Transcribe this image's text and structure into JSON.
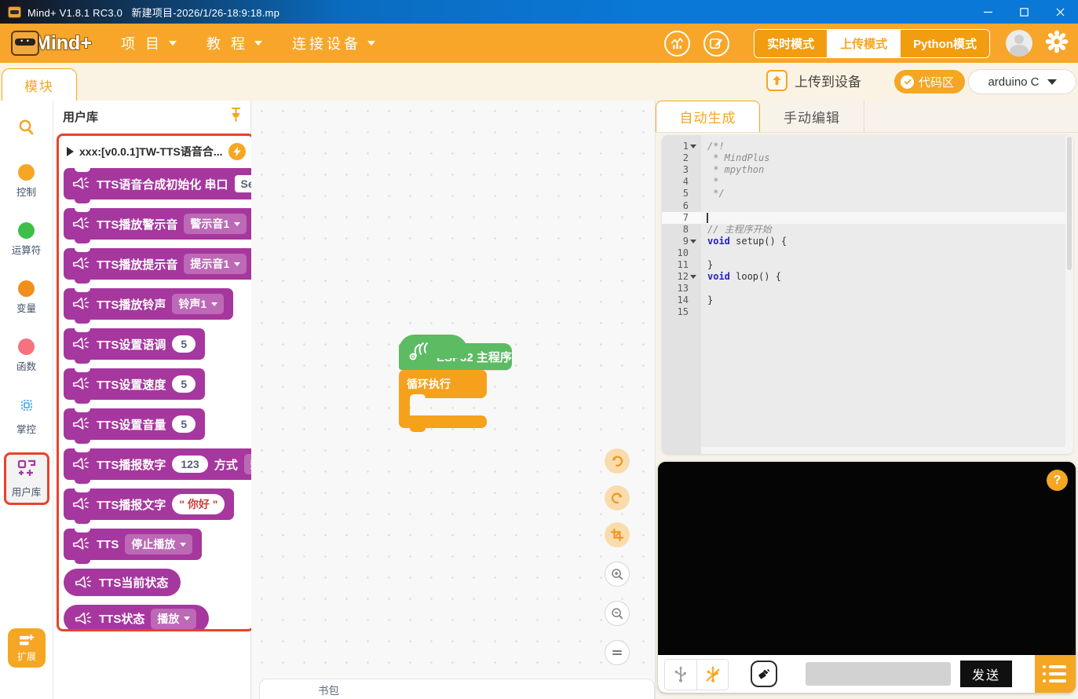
{
  "window": {
    "title": "Mind+ V1.8.1 RC3.0   新建项目-2026/1/26-18:9:18.mp"
  },
  "menu_bar": {
    "logo_text": "Mind+",
    "menus": [
      "项 目",
      "教 程",
      "连接设备"
    ],
    "modes": [
      {
        "label": "实时模式",
        "active": false
      },
      {
        "label": "上传模式",
        "active": true
      },
      {
        "label": "Python模式",
        "active": false
      }
    ]
  },
  "toolbar": {
    "module_tab": "模块",
    "upload_label": "上传到设备",
    "code_toggle": "代码区",
    "language": "arduino C"
  },
  "sidebar": {
    "categories": [
      {
        "id": "control",
        "label": "控制",
        "color": "#F5A623"
      },
      {
        "id": "operators",
        "label": "运算符",
        "color": "#3FBE49"
      },
      {
        "id": "variables",
        "label": "变量",
        "color": "#F28E1C"
      },
      {
        "id": "functions",
        "label": "函数",
        "color": "#F4737F"
      },
      {
        "id": "handpy",
        "label": "掌控",
        "icon": "chip"
      },
      {
        "id": "userlib",
        "label": "用户库",
        "icon": "blocks",
        "selected": true
      }
    ],
    "extension_label": "扩展"
  },
  "library": {
    "title": "用户库",
    "category_header": "xxx:[v0.0.1]TW-TTS语音合...",
    "block_color": "#A6379E",
    "highlight_color": "#E8432B",
    "blocks": [
      {
        "shape": "stack",
        "parts": [
          {
            "t": "label",
            "v": "TTS语音合成初始化 串口"
          },
          {
            "t": "field",
            "v": "Se"
          }
        ]
      },
      {
        "shape": "stack",
        "parts": [
          {
            "t": "label",
            "v": "TTS播放警示音"
          },
          {
            "t": "dropdown",
            "v": "警示音1"
          }
        ]
      },
      {
        "shape": "stack",
        "parts": [
          {
            "t": "label",
            "v": "TTS播放提示音"
          },
          {
            "t": "dropdown",
            "v": "提示音1"
          }
        ]
      },
      {
        "shape": "stack",
        "parts": [
          {
            "t": "label",
            "v": "TTS播放铃声"
          },
          {
            "t": "dropdown",
            "v": "铃声1"
          }
        ]
      },
      {
        "shape": "stack",
        "parts": [
          {
            "t": "label",
            "v": "TTS设置语调"
          },
          {
            "t": "num",
            "v": "5"
          }
        ]
      },
      {
        "shape": "stack",
        "parts": [
          {
            "t": "label",
            "v": "TTS设置速度"
          },
          {
            "t": "num",
            "v": "5"
          }
        ]
      },
      {
        "shape": "stack",
        "parts": [
          {
            "t": "label",
            "v": "TTS设置音量"
          },
          {
            "t": "num",
            "v": "5"
          }
        ]
      },
      {
        "shape": "stack",
        "parts": [
          {
            "t": "label",
            "v": "TTS播报数字"
          },
          {
            "t": "num",
            "v": "123"
          },
          {
            "t": "label",
            "v": "方式"
          },
          {
            "t": "dropdown",
            "v": "数"
          }
        ]
      },
      {
        "shape": "stack",
        "parts": [
          {
            "t": "label",
            "v": "TTS播报文字"
          },
          {
            "t": "str",
            "v": "你好"
          }
        ]
      },
      {
        "shape": "stack",
        "parts": [
          {
            "t": "label",
            "v": "TTS"
          },
          {
            "t": "dropdown",
            "v": "停止播放"
          }
        ]
      },
      {
        "shape": "reporter",
        "parts": [
          {
            "t": "label",
            "v": "TTS当前状态"
          }
        ]
      },
      {
        "shape": "reporter",
        "parts": [
          {
            "t": "label",
            "v": "TTS状态"
          },
          {
            "t": "dropdown",
            "v": "播放"
          }
        ]
      }
    ]
  },
  "canvas": {
    "hat_label": "ESP32 主程序",
    "loop_label": "循环执行",
    "backpack_label": "书包",
    "hat_color": "#5CBB63",
    "loop_color": "#F5A11B"
  },
  "code_panel": {
    "tabs": [
      {
        "label": "自动生成",
        "active": true
      },
      {
        "label": "手动编辑",
        "active": false
      }
    ],
    "lines": [
      {
        "n": 1,
        "fold": true,
        "tokens": [
          {
            "c": "cm",
            "v": "/*!"
          }
        ]
      },
      {
        "n": 2,
        "fold": false,
        "tokens": [
          {
            "c": "cm",
            "v": " * MindPlus"
          }
        ]
      },
      {
        "n": 3,
        "fold": false,
        "tokens": [
          {
            "c": "cm",
            "v": " * mpython"
          }
        ]
      },
      {
        "n": 4,
        "fold": false,
        "tokens": [
          {
            "c": "cm",
            "v": " *"
          }
        ]
      },
      {
        "n": 5,
        "fold": false,
        "tokens": [
          {
            "c": "cm",
            "v": " */"
          }
        ]
      },
      {
        "n": 6,
        "fold": false,
        "tokens": []
      },
      {
        "n": 7,
        "fold": false,
        "cursor": true,
        "tokens": []
      },
      {
        "n": 8,
        "fold": false,
        "tokens": [
          {
            "c": "cm",
            "v": "// 主程序开始"
          }
        ]
      },
      {
        "n": 9,
        "fold": true,
        "tokens": [
          {
            "c": "kw",
            "v": "void"
          },
          {
            "c": "pl",
            "v": " setup() {"
          }
        ]
      },
      {
        "n": 10,
        "fold": false,
        "tokens": []
      },
      {
        "n": 11,
        "fold": false,
        "tokens": [
          {
            "c": "pl",
            "v": "}"
          }
        ]
      },
      {
        "n": 12,
        "fold": true,
        "tokens": [
          {
            "c": "kw",
            "v": "void"
          },
          {
            "c": "pl",
            "v": " loop() {"
          }
        ]
      },
      {
        "n": 13,
        "fold": false,
        "tokens": []
      },
      {
        "n": 14,
        "fold": false,
        "tokens": [
          {
            "c": "pl",
            "v": "}"
          }
        ]
      },
      {
        "n": 15,
        "fold": false,
        "tokens": []
      }
    ]
  },
  "console": {
    "help_label": "?",
    "send_label": "发送",
    "input_value": ""
  }
}
